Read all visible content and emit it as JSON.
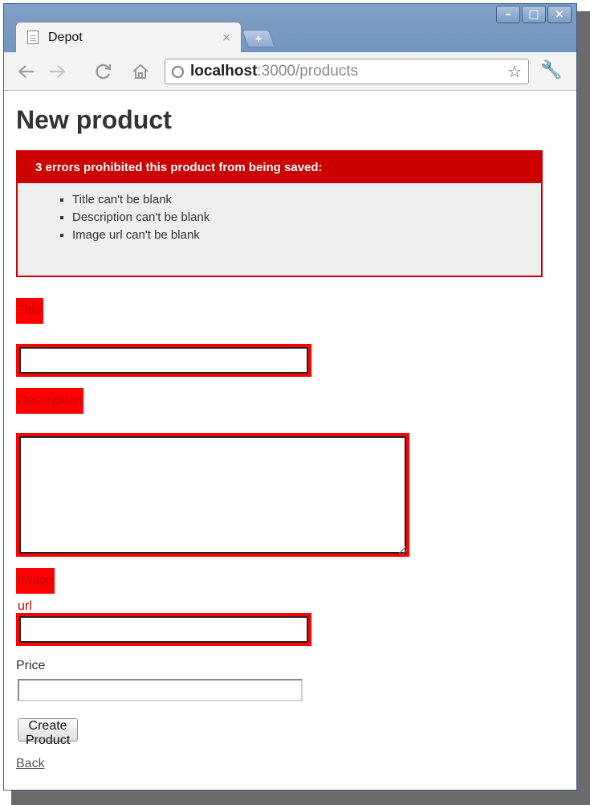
{
  "browser": {
    "tab": {
      "title": "Depot",
      "close_icon": "×",
      "icon": "page-icon"
    },
    "new_tab_icon": "+",
    "window_controls": {
      "minimize": "–",
      "maximize": "□",
      "close": "×"
    },
    "toolbar": {
      "back_icon": "back-arrow-icon",
      "forward_icon": "forward-arrow-icon",
      "reload_icon": "reload-icon",
      "home_icon": "home-icon",
      "url_host": "localhost",
      "url_rest": ":3000/products",
      "bookmark_icon": "star-icon",
      "menu_icon": "wrench-icon"
    }
  },
  "page": {
    "title": "New product",
    "error_box": {
      "header": "3 errors prohibited this product from being saved:",
      "errors": [
        "Title can't be blank",
        "Description can't be blank",
        "Image url can't be blank"
      ]
    },
    "fields": {
      "title_label": "Title",
      "title_value": "",
      "description_label": "Description",
      "description_value": "",
      "image_url_label": "Image url",
      "image_url_value": "",
      "price_label": "Price",
      "price_value": ""
    },
    "submit_label": "Create Product",
    "back_link": "Back"
  },
  "colors": {
    "error_red": "#cc0000",
    "field_error_bg": "#ff0000",
    "error_box_bg": "#eeeeee",
    "frame_blue": "#6a8cb8"
  }
}
